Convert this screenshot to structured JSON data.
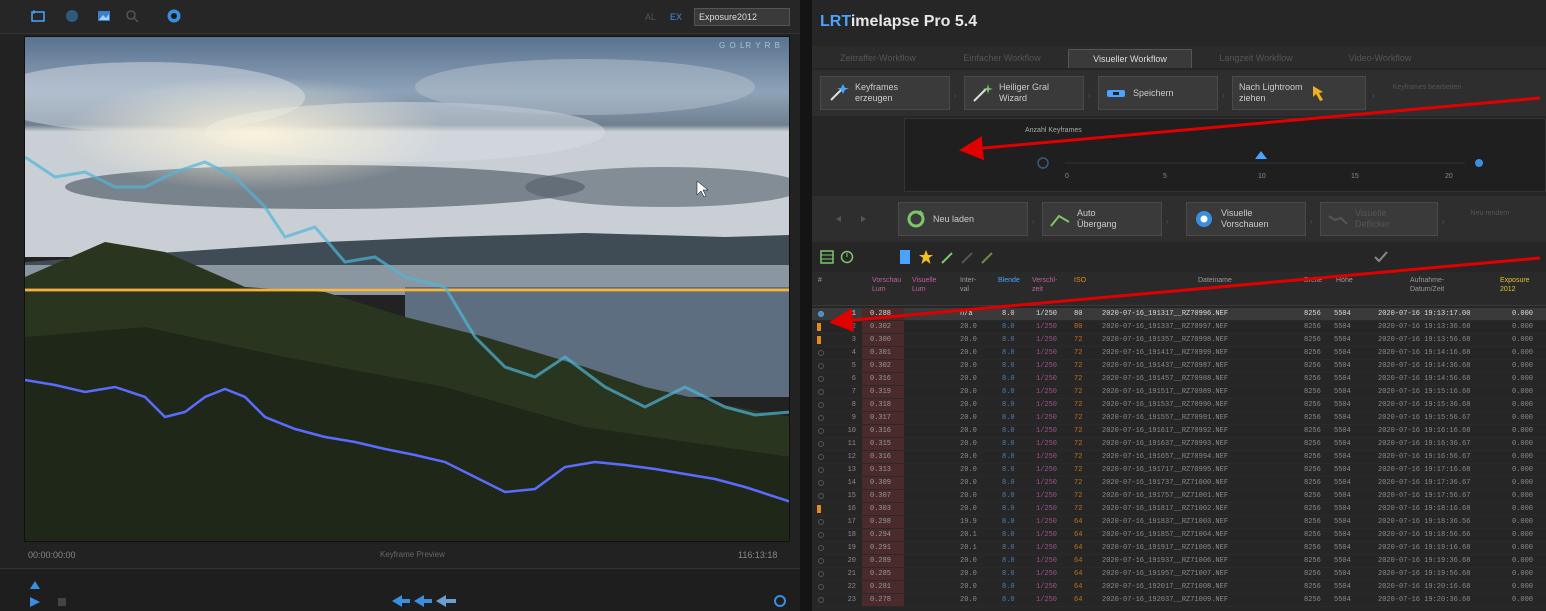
{
  "left_toolbar": {
    "sequence_field": "Exposure2012",
    "icons": [
      "crop-icon",
      "info-icon",
      "image-icon",
      "zoom-icon",
      "target-icon"
    ]
  },
  "preview": {
    "overlay_label": "G  O  LR  Y  R  B"
  },
  "timeline": {
    "start": "00:00:00:00",
    "center": "Keyframe Preview",
    "end": "116:13:18"
  },
  "app": {
    "title_prefix": "LRT",
    "title_rest": "imelapse Pro 5.4"
  },
  "tabs": [
    {
      "label": "Zeitraffer-Workflow"
    },
    {
      "label": "Einfacher Workflow"
    },
    {
      "label": "Visueller Workflow",
      "active": true
    },
    {
      "label": "Langzeit Workflow"
    },
    {
      "label": "Video-Workflow"
    }
  ],
  "workflow_buttons": [
    {
      "label_line1": "Keyframes",
      "label_line2": "erzeugen"
    },
    {
      "label_line1": "Heiliger Gral",
      "label_line2": "Wizard"
    },
    {
      "label_line1": "Speichern",
      "label_line2": ""
    },
    {
      "label_line1": "Nach Lightroom",
      "label_line2": "ziehen"
    }
  ],
  "workflow_dimmed": "Keyframes bearbeiten",
  "keyframes_panel": {
    "title": "Anzahl Keyframes",
    "ticks": [
      "0",
      "5",
      "10",
      "15",
      "20"
    ]
  },
  "action_buttons": [
    {
      "label_line1": "Neu laden",
      "label_line2": ""
    },
    {
      "label_line1": "Auto",
      "label_line2": "Übergang"
    },
    {
      "label_line1": "Visuelle",
      "label_line2": "Vorschauen"
    },
    {
      "label_line1": "Visuelle",
      "label_line2": "Deflicker"
    }
  ],
  "action_dimmed": "Neu rendern",
  "columns": [
    {
      "l1": "#",
      "l2": ""
    },
    {
      "l1": "Vorschau",
      "l2": "Lum"
    },
    {
      "l1": "Visuelle",
      "l2": "Lum"
    },
    {
      "l1": "Inter-",
      "l2": "val"
    },
    {
      "l1": "Blende",
      "l2": ""
    },
    {
      "l1": "Verschl-",
      "l2": "zeit"
    },
    {
      "l1": "ISO",
      "l2": ""
    },
    {
      "l1": "Dateiname",
      "l2": ""
    },
    {
      "l1": "Breite",
      "l2": ""
    },
    {
      "l1": "Höhe",
      "l2": ""
    },
    {
      "l1": "Aufnahme-",
      "l2": "Datum/Zeit"
    },
    {
      "l1": "Exposure",
      "l2": "2012"
    }
  ],
  "rows": [
    {
      "n": "1",
      "lum": "0.288",
      "iv": "n/a",
      "ap": "8.0",
      "sh": "1/250",
      "iso": "80",
      "file": "2020-07-16_191317__RZ70996.NEF",
      "w": "8256",
      "h": "5504",
      "dt": "2020-07-16 19:13:17.00",
      "exp": "0.000"
    },
    {
      "n": "2",
      "lum": "0.302",
      "iv": "20.0",
      "ap": "8.0",
      "sh": "1/250",
      "iso": "80",
      "file": "2020-07-16_191337__RZ70997.NEF",
      "w": "8256",
      "h": "5504",
      "dt": "2020-07-16 19:13:36.68",
      "exp": "0.000"
    },
    {
      "n": "3",
      "lum": "0.300",
      "iv": "20.0",
      "ap": "8.0",
      "sh": "1/250",
      "iso": "72",
      "file": "2020-07-16_191357__RZ70998.NEF",
      "w": "8256",
      "h": "5504",
      "dt": "2020-07-16 19:13:56.68",
      "exp": "0.000"
    },
    {
      "n": "4",
      "lum": "0.301",
      "iv": "20.0",
      "ap": "8.0",
      "sh": "1/250",
      "iso": "72",
      "file": "2020-07-16_191417__RZ70999.NEF",
      "w": "8256",
      "h": "5504",
      "dt": "2020-07-16 19:14:16.68",
      "exp": "0.000"
    },
    {
      "n": "5",
      "lum": "0.302",
      "iv": "20.0",
      "ap": "8.0",
      "sh": "1/250",
      "iso": "72",
      "file": "2020-07-16_191437__RZ70987.NEF",
      "w": "8256",
      "h": "5504",
      "dt": "2020-07-16 19:14:36.68",
      "exp": "0.000"
    },
    {
      "n": "6",
      "lum": "0.316",
      "iv": "20.0",
      "ap": "8.0",
      "sh": "1/250",
      "iso": "72",
      "file": "2020-07-16_191457__RZ70988.NEF",
      "w": "8256",
      "h": "5504",
      "dt": "2020-07-16 19:14:56.68",
      "exp": "0.000"
    },
    {
      "n": "7",
      "lum": "0.319",
      "iv": "20.0",
      "ap": "8.0",
      "sh": "1/250",
      "iso": "72",
      "file": "2020-07-16_191517__RZ70989.NEF",
      "w": "8256",
      "h": "5504",
      "dt": "2020-07-16 19:15:16.68",
      "exp": "0.000"
    },
    {
      "n": "8",
      "lum": "0.318",
      "iv": "20.0",
      "ap": "8.0",
      "sh": "1/250",
      "iso": "72",
      "file": "2020-07-16_191537__RZ70990.NEF",
      "w": "8256",
      "h": "5504",
      "dt": "2020-07-16 19:15:36.68",
      "exp": "0.000"
    },
    {
      "n": "9",
      "lum": "0.317",
      "iv": "20.0",
      "ap": "8.0",
      "sh": "1/250",
      "iso": "72",
      "file": "2020-07-16_191557__RZ70991.NEF",
      "w": "8256",
      "h": "5504",
      "dt": "2020-07-16 19:15:56.67",
      "exp": "0.000"
    },
    {
      "n": "10",
      "lum": "0.316",
      "iv": "20.0",
      "ap": "8.0",
      "sh": "1/250",
      "iso": "72",
      "file": "2020-07-16_191617__RZ70992.NEF",
      "w": "8256",
      "h": "5504",
      "dt": "2020-07-16 19:16:16.68",
      "exp": "0.000"
    },
    {
      "n": "11",
      "lum": "0.315",
      "iv": "20.0",
      "ap": "8.0",
      "sh": "1/250",
      "iso": "72",
      "file": "2020-07-16_191637__RZ70993.NEF",
      "w": "8256",
      "h": "5504",
      "dt": "2020-07-16 19:16:36.67",
      "exp": "0.000"
    },
    {
      "n": "12",
      "lum": "0.316",
      "iv": "20.0",
      "ap": "8.0",
      "sh": "1/250",
      "iso": "72",
      "file": "2020-07-16_191657__RZ70994.NEF",
      "w": "8256",
      "h": "5504",
      "dt": "2020-07-16 19:16:56.67",
      "exp": "0.000"
    },
    {
      "n": "13",
      "lum": "0.313",
      "iv": "20.0",
      "ap": "8.0",
      "sh": "1/250",
      "iso": "72",
      "file": "2020-07-16_191717__RZ70995.NEF",
      "w": "8256",
      "h": "5504",
      "dt": "2020-07-16 19:17:16.68",
      "exp": "0.000"
    },
    {
      "n": "14",
      "lum": "0.309",
      "iv": "20.0",
      "ap": "8.0",
      "sh": "1/250",
      "iso": "72",
      "file": "2020-07-16_191737__RZ71000.NEF",
      "w": "8256",
      "h": "5504",
      "dt": "2020-07-16 19:17:36.67",
      "exp": "0.000"
    },
    {
      "n": "15",
      "lum": "0.307",
      "iv": "20.0",
      "ap": "8.0",
      "sh": "1/250",
      "iso": "72",
      "file": "2020-07-16_191757__RZ71001.NEF",
      "w": "8256",
      "h": "5504",
      "dt": "2020-07-16 19:17:56.67",
      "exp": "0.000"
    },
    {
      "n": "16",
      "lum": "0.303",
      "iv": "20.0",
      "ap": "8.0",
      "sh": "1/250",
      "iso": "72",
      "file": "2020-07-16_191817__RZ71002.NEF",
      "w": "8256",
      "h": "5504",
      "dt": "2020-07-16 19:18:16.68",
      "exp": "0.000"
    },
    {
      "n": "17",
      "lum": "0.298",
      "iv": "19.9",
      "ap": "8.0",
      "sh": "1/250",
      "iso": "64",
      "file": "2020-07-16_191837__RZ71003.NEF",
      "w": "8256",
      "h": "5504",
      "dt": "2020-07-16 19:18:36.56",
      "exp": "0.000"
    },
    {
      "n": "18",
      "lum": "0.294",
      "iv": "20.1",
      "ap": "8.0",
      "sh": "1/250",
      "iso": "64",
      "file": "2020-07-16_191857__RZ71004.NEF",
      "w": "8256",
      "h": "5504",
      "dt": "2020-07-16 19:18:56.66",
      "exp": "0.000"
    },
    {
      "n": "19",
      "lum": "0.291",
      "iv": "20.1",
      "ap": "8.0",
      "sh": "1/250",
      "iso": "64",
      "file": "2020-07-16_191917__RZ71005.NEF",
      "w": "8256",
      "h": "5504",
      "dt": "2020-07-16 19:19:16.68",
      "exp": "0.000"
    },
    {
      "n": "20",
      "lum": "0.289",
      "iv": "20.0",
      "ap": "8.0",
      "sh": "1/250",
      "iso": "64",
      "file": "2020-07-16_191937__RZ71006.NEF",
      "w": "8256",
      "h": "5504",
      "dt": "2020-07-16 19:19:36.68",
      "exp": "0.000"
    },
    {
      "n": "21",
      "lum": "0.285",
      "iv": "20.0",
      "ap": "8.0",
      "sh": "1/250",
      "iso": "64",
      "file": "2020-07-16_191957__RZ71007.NEF",
      "w": "8256",
      "h": "5504",
      "dt": "2020-07-16 19:19:56.68",
      "exp": "0.000"
    },
    {
      "n": "22",
      "lum": "0.281",
      "iv": "20.0",
      "ap": "8.0",
      "sh": "1/250",
      "iso": "64",
      "file": "2020-07-16_192017__RZ71008.NEF",
      "w": "8256",
      "h": "5504",
      "dt": "2020-07-16 19:20:16.68",
      "exp": "0.000"
    },
    {
      "n": "23",
      "lum": "0.278",
      "iv": "20.0",
      "ap": "8.0",
      "sh": "1/250",
      "iso": "64",
      "file": "2020-07-16_192037__RZ71009.NEF",
      "w": "8256",
      "h": "5504",
      "dt": "2020-07-16 19:20:36.68",
      "exp": "0.000"
    }
  ],
  "colors": {
    "accent_blue": "#4aa3ff",
    "annotation_arrow": "#e00000",
    "orange_line": "#f0a020",
    "lum_curve": "#5a6cff",
    "visual_curve": "#4fb6d8"
  }
}
